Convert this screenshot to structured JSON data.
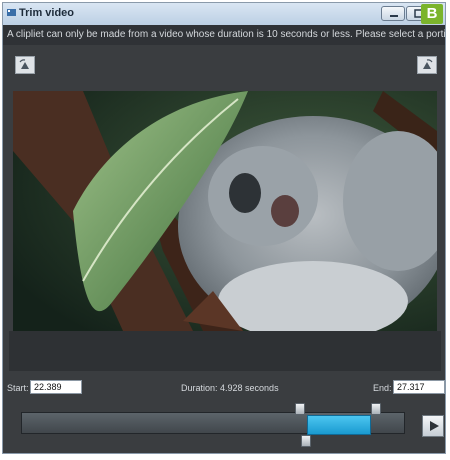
{
  "window": {
    "title": "Trim video",
    "badge": "B"
  },
  "instructions": "A clipliet can only be made from a video whose duration is 10 seconds or less. Please select a portion of the video below.",
  "trim": {
    "start_label": "Start:",
    "start_value": "22.389",
    "duration_text": "Duration: 4.928 seconds",
    "end_label": "End:",
    "end_value": "27.317"
  },
  "icons": {
    "window_icon": "video-icon",
    "minimize": "minimize-icon",
    "maximize": "maximize-icon",
    "rotate_left": "rotate-left-icon",
    "rotate_right": "rotate-right-icon",
    "play": "play-icon"
  },
  "colors": {
    "selection": "#1a9ad0",
    "badge": "#7bb42c",
    "titlebar": "#c9d9ea"
  }
}
